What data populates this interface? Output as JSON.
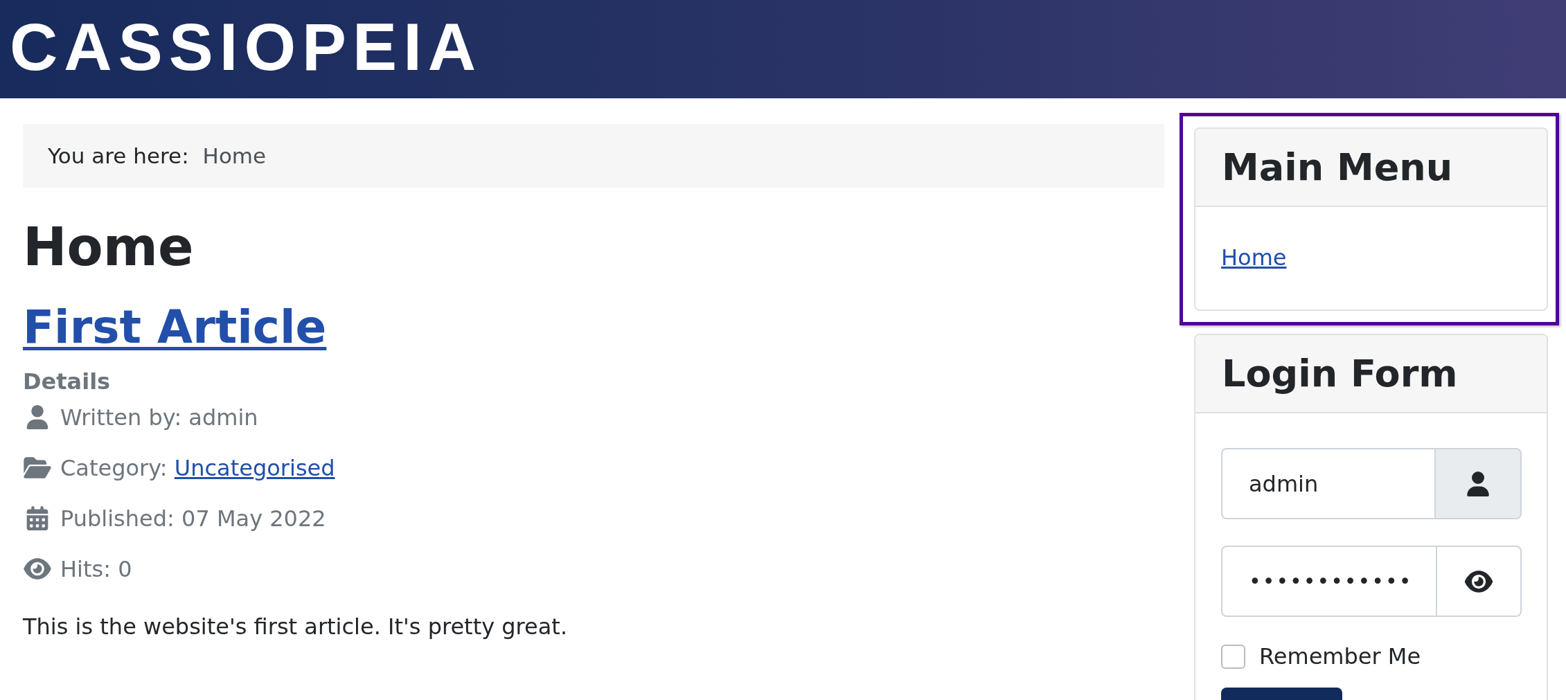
{
  "header": {
    "logo": "CASSIOPEIA"
  },
  "breadcrumb": {
    "label": "You are here:",
    "items": [
      {
        "text": "Home"
      }
    ]
  },
  "page_title": "Home",
  "article": {
    "title": "First Article",
    "details_heading": "Details",
    "meta": [
      {
        "kind": "author",
        "label": "Written by: admin"
      },
      {
        "kind": "category",
        "label": "Category: ",
        "link": "Uncategorised"
      },
      {
        "kind": "published",
        "label": "Published: 07 May 2022"
      },
      {
        "kind": "hits",
        "label": "Hits: 0"
      }
    ],
    "body": "This is the website's first article. It's pretty great."
  },
  "sidebar": {
    "modules": [
      {
        "kind": "menu",
        "title": "Main Menu",
        "highlighted": true,
        "items": [
          {
            "label": "Home"
          }
        ]
      },
      {
        "kind": "login",
        "title": "Login Form",
        "highlighted": false,
        "username": {
          "value": "admin"
        },
        "password": {
          "value": "••••••••••••"
        },
        "remember": {
          "label": "Remember Me",
          "checked": false
        }
      }
    ]
  }
}
